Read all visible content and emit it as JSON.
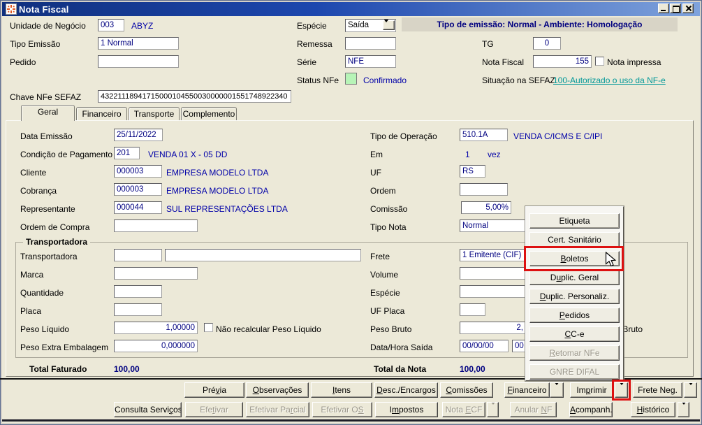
{
  "window": {
    "title": "Nota Fiscal"
  },
  "colors": {
    "accent_navy": "#000080",
    "link_teal": "#009898",
    "status_green": "#b7f4b7",
    "highlight_red": "#dd1111",
    "banner_bg": "#d8d4c6"
  },
  "header": {
    "unidade_negocio": {
      "label": "Unidade de Negócio",
      "code": "003",
      "desc": "ABYZ"
    },
    "tipo_emissao": {
      "label": "Tipo Emissão",
      "value": "1 Normal"
    },
    "pedido": {
      "label": "Pedido",
      "value": ""
    },
    "chave": {
      "label": "Chave NFe SEFAZ",
      "value": "43221118941715000104550030000001551748922340"
    },
    "especie": {
      "label": "Espécie",
      "value": "Saída"
    },
    "remessa": {
      "label": "Remessa",
      "value": ""
    },
    "serie": {
      "label": "Série",
      "value": "NFE"
    },
    "status_nfe": {
      "label": "Status NFe",
      "value": "Confirmado"
    },
    "banner": "Tipo de emissão: Normal - Ambiente: Homologação",
    "tg": {
      "label": "TG",
      "value": "0"
    },
    "nota_fiscal": {
      "label": "Nota Fiscal",
      "value": "155"
    },
    "nota_impressa": {
      "label": "Nota impressa",
      "checked": false
    },
    "situacao": {
      "label": "Situação na SEFAZ",
      "link": "100-Autorizado o uso da NF-e"
    }
  },
  "tabs": [
    {
      "label": "Geral"
    },
    {
      "label": "Financeiro"
    },
    {
      "label": "Transporte"
    },
    {
      "label": "Complemento"
    }
  ],
  "geral": {
    "data_emissao": {
      "label": "Data Emissão",
      "value": "25/11/2022"
    },
    "cond_pagamento": {
      "label": "Condição de Pagamento",
      "code": "201",
      "desc": "VENDA 01 X - 05 DD"
    },
    "cliente": {
      "label": "Cliente",
      "code": "000003",
      "desc": "EMPRESA MODELO LTDA"
    },
    "cobranca": {
      "label": "Cobrança",
      "code": "000003",
      "desc": "EMPRESA MODELO LTDA"
    },
    "representante": {
      "label": "Representante",
      "code": "000044",
      "desc": "SUL REPRESENTAÇÕES LTDA"
    },
    "ordem_compra": {
      "label": "Ordem de Compra",
      "value": ""
    },
    "tipo_operacao": {
      "label": "Tipo de Operação",
      "code": "510.1A",
      "desc": "VENDA C/ICMS E C/IPI"
    },
    "em": {
      "label": "Em",
      "value": "1",
      "unit": "vez"
    },
    "uf": {
      "label": "UF",
      "value": "RS"
    },
    "ordem": {
      "label": "Ordem",
      "value": ""
    },
    "comissao": {
      "label": "Comissão",
      "value": "5,00%"
    },
    "tipo_nota": {
      "label": "Tipo Nota",
      "value": "Normal"
    },
    "grupo_transportadora": {
      "legend": "Transportadora",
      "transportadora": {
        "label": "Transportadora",
        "code": "",
        "desc": ""
      },
      "marca": {
        "label": "Marca",
        "value": ""
      },
      "quantidade": {
        "label": "Quantidade",
        "value": ""
      },
      "placa": {
        "label": "Placa",
        "value": ""
      },
      "peso_liquido": {
        "label": "Peso Líquido",
        "value": "1,00000",
        "checkbox": "Não recalcular Peso Líquido",
        "checked": false
      },
      "peso_extra": {
        "label": "Peso Extra Embalagem",
        "value": "0,000000"
      },
      "frete": {
        "label": "Frete",
        "value": "1 Emitente (CIF)"
      },
      "volume": {
        "label": "Volume",
        "value": ""
      },
      "especie": {
        "label": "Espécie",
        "value": ""
      },
      "uf_placa": {
        "label": "UF Placa",
        "value": ""
      },
      "peso_bruto": {
        "label": "Peso Bruto",
        "value": "2,",
        "checkbox": "Não recalcular Peso Bruto",
        "checked": false
      },
      "data_hora_saida": {
        "label": "Data/Hora Saída",
        "date": "00/00/00",
        "time": "00"
      }
    },
    "total_faturado": {
      "label": "Total Faturado",
      "value": "100,00"
    },
    "total_nota": {
      "label": "Total da Nota",
      "value": "100,00"
    }
  },
  "context_menu": {
    "items": [
      {
        "label": "Etiqueta",
        "u": -1
      },
      {
        "label": "Cert. Sanitário",
        "u": -1
      },
      {
        "label": "Boletos",
        "u": 0
      },
      {
        "label": "Duplic. Geral",
        "u": 1
      },
      {
        "label": "Duplic. Personaliz.",
        "u": 0
      },
      {
        "label": "Pedidos",
        "u": 0
      },
      {
        "label": "CC-e",
        "u": 0
      },
      {
        "label": "Retomar NFe",
        "u": 0
      },
      {
        "label": "GNRE DIFAL",
        "u": -1
      }
    ]
  },
  "toolbar": {
    "row1": [
      {
        "label": "Prévia",
        "u": 3
      },
      {
        "label": "Observações",
        "u": 0
      },
      {
        "label": "Itens",
        "u": 0
      },
      {
        "label": "Desc./Encargos",
        "u": 0
      },
      {
        "label": "Comissões",
        "u": 0
      },
      {
        "label": "Financeiro",
        "u": 0
      },
      {
        "label": "Imprimir",
        "u": 2
      },
      {
        "label": "Frete Neg.",
        "u": 8
      }
    ],
    "row2": [
      {
        "label": "Consulta Serviços",
        "u": 14
      },
      {
        "label": "Efetivar",
        "u": 3
      },
      {
        "label": "Efetivar Parcial",
        "u": 11
      },
      {
        "label": "Efetivar OS",
        "u": 10
      },
      {
        "label": "Impostos",
        "u": 1
      },
      {
        "label": "Nota ECF",
        "u": 5
      },
      {
        "label": "Anular NF",
        "u": 7
      },
      {
        "label": "Acompanh.",
        "u": 0
      },
      {
        "label": "Histórico",
        "u": 0
      }
    ]
  }
}
